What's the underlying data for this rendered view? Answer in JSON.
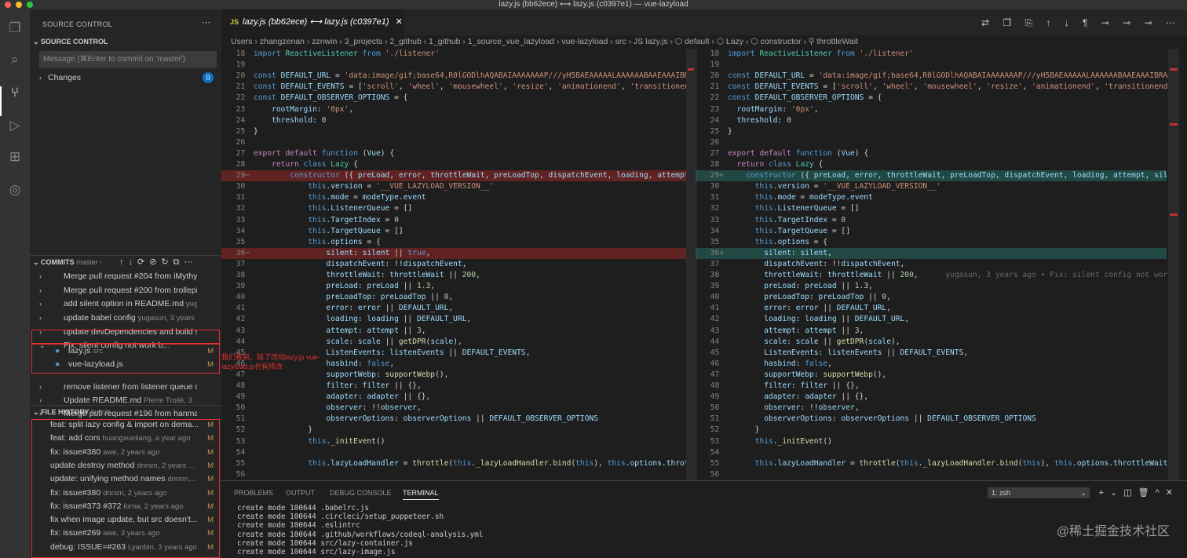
{
  "window": {
    "title": "lazy.js (bb62ece) ⟷ lazy.js (c0397e1) — vue-lazyload"
  },
  "activity": [
    "files-icon",
    "search-icon",
    "source-control-icon",
    "run-debug-icon",
    "extensions-icon",
    "git-graph-icon"
  ],
  "sidebar": {
    "header": "SOURCE CONTROL",
    "section": "SOURCE CONTROL",
    "message_placeholder": "Message (⌘Enter to commit on 'master')",
    "changes_label": "Changes",
    "changes_count": "0",
    "commits_label": "COMMITS",
    "commits_branch": "master -",
    "commits": [
      {
        "msg": "Merge pull request #204 from iMythy...",
        "author": ""
      },
      {
        "msg": "Merge pull request #200 from trollepi...",
        "author": ""
      },
      {
        "msg": "add silent option in README.md",
        "author": "yuga..."
      },
      {
        "msg": "update babel config",
        "author": "yugasun, 3 years a..."
      },
      {
        "msg": "update devDependencies and build sc...",
        "author": ""
      },
      {
        "msg": "Fix: silent config not work b...",
        "author": ""
      },
      {
        "msg": "remove listener from listener queue o...",
        "author": ""
      },
      {
        "msg": "Update README.md",
        "author": "Pierre Trollé, 3 ..."
      },
      {
        "msg": "Merge pull request #196 from hanmac...",
        "author": ""
      }
    ],
    "files": [
      {
        "name": "lazy.js",
        "dir": "src",
        "status": "M"
      },
      {
        "name": "vue-lazyload.js",
        "dir": "",
        "status": "M"
      }
    ],
    "history_label": "FILE HISTORY",
    "history_file": "lazy.js",
    "history": [
      {
        "msg": "feat: split lazy config & import on dema...",
        "author": "",
        "status": "M"
      },
      {
        "msg": "feat: add cors",
        "author": "huangxueliang, a year ago",
        "status": "M"
      },
      {
        "msg": "fix: issue#380",
        "author": "awe, 2 years ago",
        "status": "M"
      },
      {
        "msg": "update destroy method",
        "author": "dnrsm, 2 years ...",
        "status": "M"
      },
      {
        "msg": "update: unifying method names",
        "author": "dnrsm,...",
        "status": "M"
      },
      {
        "msg": "fix: issue#380",
        "author": "dnrsm, 2 years ago",
        "status": "M"
      },
      {
        "msg": "fix: issue#373 #372",
        "author": "lorna, 2 years ago",
        "status": "M"
      },
      {
        "msg": "fix when image update, but src doesn't...",
        "author": "",
        "status": "M"
      },
      {
        "msg": "fix: issue#269",
        "author": "awe, 3 years ago",
        "status": "M"
      },
      {
        "msg": "debug: ISSUE=#263",
        "author": "Lyanbin, 3 years ago",
        "status": "M"
      }
    ]
  },
  "annotation": "我们看到，除了改动lazy.js vue-lazyload.js也有修改",
  "editor": {
    "tab": "lazy.js (bb62ece) ⟷ lazy.js (c0397e1)",
    "tab_icon": "JS",
    "toolbar": "⇄ ❐ ⎘ ↑ ↓ ¶ ⊸ ⊸ ⊸ ⋯",
    "breadcrumb": "Users › zhangzenan › zznwin › 3_projects › 2_github › 1_github › 1_source_vue_lazyload › vue-lazyload › src › JS lazy.js › ⬡ default › ⬡ Lazy › ⬡ constructor › ⚲ throttleWait",
    "blame": "yugasun, 3 years ago • Fix: silent config not wor",
    "left": [
      [
        "18",
        "<span class='k'>import</span> <span class='c'>ReactiveListener</span> <span class='k'>from</span> <span class='s'>'./listener'</span>",
        ""
      ],
      [
        "19",
        "",
        ""
      ],
      [
        "20",
        "<span class='k'>const</span> <span class='v'>DEFAULT_URL</span> = <span class='s'>'data:image/gif;base64,R0lGODlhAQABAIAAAAAAAP///yH5BAEAAAAALAAAAAABAAEAAAIBRAA7'</span>",
        ""
      ],
      [
        "21",
        "<span class='k'>const</span> <span class='v'>DEFAULT_EVENTS</span> = [<span class='s'>'scroll'</span>, <span class='s'>'wheel'</span>, <span class='s'>'mousewheel'</span>, <span class='s'>'resize'</span>, <span class='s'>'animationend'</span>, <span class='s'>'transitionend'</span>",
        ""
      ],
      [
        "22",
        "<span class='k'>const</span> <span class='v'>DEFAULT_OBSERVER_OPTIONS</span> = {",
        ""
      ],
      [
        "23",
        "    <span class='v'>rootMargin</span>: <span class='s'>'0px'</span>,",
        ""
      ],
      [
        "24",
        "    <span class='v'>threshold</span>: <span class='n'>0</span>",
        ""
      ],
      [
        "25",
        "}",
        ""
      ],
      [
        "26",
        "",
        ""
      ],
      [
        "27",
        "<span class='p'>export</span> <span class='p'>default</span> <span class='k'>function</span> (<span class='v'>Vue</span>) {",
        ""
      ],
      [
        "28",
        "    <span class='p'>return</span> <span class='k'>class</span> <span class='c'>Lazy</span> {",
        ""
      ],
      [
        "29",
        "        <span class='k'>constructor</span> ({ <span class='v'>preLoad</span>, <span class='v'>error</span>, <span class='v'>throttleWait</span>, <span class='v'>preLoadTop</span>, <span class='v'>dispatchEvent</span>, <span class='v'>loading</span>, <span class='v'>attempt</span>, <span class='v'>s</span>",
        "del"
      ],
      [
        "30",
        "            <span class='k'>this</span>.<span class='v'>version</span> = <span class='s'>'__VUE_LAZYLOAD_VERSION__'</span>",
        ""
      ],
      [
        "31",
        "            <span class='k'>this</span>.<span class='v'>mode</span> = <span class='v'>modeType</span>.<span class='v'>event</span>",
        ""
      ],
      [
        "32",
        "            <span class='k'>this</span>.<span class='v'>ListenerQueue</span> = []",
        ""
      ],
      [
        "33",
        "            <span class='k'>this</span>.<span class='v'>TargetIndex</span> = <span class='n'>0</span>",
        ""
      ],
      [
        "34",
        "            <span class='k'>this</span>.<span class='v'>TargetQueue</span> = []",
        ""
      ],
      [
        "35",
        "            <span class='k'>this</span>.<span class='v'>options</span> = {",
        ""
      ],
      [
        "36",
        "                <span class='v'>silent</span>: <span class='v'>silent</span> || <span class='k'>true</span>,",
        "del"
      ],
      [
        "37",
        "                <span class='v'>dispatchEvent</span>: !!<span class='v'>dispatchEvent</span>,",
        ""
      ],
      [
        "38",
        "                <span class='v'>throttleWait</span>: <span class='v'>throttleWait</span> || <span class='n'>200</span>,",
        ""
      ],
      [
        "39",
        "                <span class='v'>preLoad</span>: <span class='v'>preLoad</span> || <span class='n'>1.3</span>,",
        ""
      ],
      [
        "40",
        "                <span class='v'>preLoadTop</span>: <span class='v'>preLoadTop</span> || <span class='n'>0</span>,",
        ""
      ],
      [
        "41",
        "                <span class='v'>error</span>: <span class='v'>error</span> || <span class='v'>DEFAULT_URL</span>,",
        ""
      ],
      [
        "42",
        "                <span class='v'>loading</span>: <span class='v'>loading</span> || <span class='v'>DEFAULT_URL</span>,",
        ""
      ],
      [
        "43",
        "                <span class='v'>attempt</span>: <span class='v'>attempt</span> || <span class='n'>3</span>,",
        ""
      ],
      [
        "44",
        "                <span class='v'>scale</span>: <span class='v'>scale</span> || <span class='f'>getDPR</span>(<span class='v'>scale</span>),",
        ""
      ],
      [
        "45",
        "                <span class='v'>ListenEvents</span>: <span class='v'>listenEvents</span> || <span class='v'>DEFAULT_EVENTS</span>,",
        ""
      ],
      [
        "46",
        "                <span class='v'>hasbind</span>: <span class='k'>false</span>,",
        ""
      ],
      [
        "47",
        "                <span class='v'>supportWebp</span>: <span class='f'>supportWebp</span>(),",
        ""
      ],
      [
        "48",
        "                <span class='v'>filter</span>: <span class='v'>filter</span> || {},",
        ""
      ],
      [
        "49",
        "                <span class='v'>adapter</span>: <span class='v'>adapter</span> || {},",
        ""
      ],
      [
        "50",
        "                <span class='v'>observer</span>: !!<span class='v'>observer</span>,",
        ""
      ],
      [
        "51",
        "                <span class='v'>observerOptions</span>: <span class='v'>observerOptions</span> || <span class='v'>DEFAULT_OBSERVER_OPTIONS</span>",
        ""
      ],
      [
        "52",
        "            }",
        ""
      ],
      [
        "53",
        "            <span class='k'>this</span>.<span class='f'>_initEvent</span>()",
        ""
      ],
      [
        "54",
        "",
        ""
      ],
      [
        "55",
        "            <span class='k'>this</span>.<span class='v'>lazyLoadHandler</span> = <span class='f'>throttle</span>(<span class='k'>this</span>.<span class='f'>_lazyLoadHandler</span>.<span class='f'>bind</span>(<span class='k'>this</span>), <span class='k'>this</span>.<span class='v'>options</span>.<span class='v'>throttl</span>",
        ""
      ],
      [
        "56",
        "",
        ""
      ]
    ],
    "right": [
      [
        "18",
        "<span class='k'>import</span> <span class='c'>ReactiveListener</span> <span class='k'>from</span> <span class='s'>'./listener'</span>",
        ""
      ],
      [
        "19",
        "",
        ""
      ],
      [
        "20",
        "<span class='k'>const</span> <span class='v'>DEFAULT_URL</span> = <span class='s'>'data:image/gif;base64,R0lGODlhAQABAIAAAAAAAP///yH5BAEAAAAALAAAAAABAAEAAAIBRAA7'</span>",
        ""
      ],
      [
        "21",
        "<span class='k'>const</span> <span class='v'>DEFAULT_EVENTS</span> = [<span class='s'>'scroll'</span>, <span class='s'>'wheel'</span>, <span class='s'>'mousewheel'</span>, <span class='s'>'resize'</span>, <span class='s'>'animationend'</span>, <span class='s'>'transitionend'</span>",
        ""
      ],
      [
        "22",
        "<span class='k'>const</span> <span class='v'>DEFAULT_OBSERVER_OPTIONS</span> = {",
        ""
      ],
      [
        "23",
        "  <span class='v'>rootMargin</span>: <span class='s'>'0px'</span>,",
        ""
      ],
      [
        "24",
        "  <span class='v'>threshold</span>: <span class='n'>0</span>",
        ""
      ],
      [
        "25",
        "}",
        ""
      ],
      [
        "26",
        "",
        ""
      ],
      [
        "27",
        "<span class='p'>export</span> <span class='p'>default</span> <span class='k'>function</span> (<span class='v'>Vue</span>) {",
        ""
      ],
      [
        "28",
        "  <span class='p'>return</span> <span class='k'>class</span> <span class='c'>Lazy</span> {",
        ""
      ],
      [
        "29",
        "    <span class='k'>constructor</span> ({ <span class='v'>preLoad</span>, <span class='v'>error</span>, <span class='v'>throttleWait</span>, <span class='v'>preLoadTop</span>, <span class='v'>dispatchEvent</span>, <span class='v'>loading</span>, <span class='v'>attempt</span>, <span class='v'>silen</span>",
        "add"
      ],
      [
        "30",
        "      <span class='k'>this</span>.<span class='v'>version</span> = <span class='s'>'__VUE_LAZYLOAD_VERSION__'</span>",
        ""
      ],
      [
        "31",
        "      <span class='k'>this</span>.<span class='v'>mode</span> = <span class='v'>modeType</span>.<span class='v'>event</span>",
        ""
      ],
      [
        "32",
        "      <span class='k'>this</span>.<span class='v'>ListenerQueue</span> = []",
        ""
      ],
      [
        "33",
        "      <span class='k'>this</span>.<span class='v'>TargetIndex</span> = <span class='n'>0</span>",
        ""
      ],
      [
        "34",
        "      <span class='k'>this</span>.<span class='v'>TargetQueue</span> = []",
        ""
      ],
      [
        "35",
        "      <span class='k'>this</span>.<span class='v'>options</span> = {",
        ""
      ],
      [
        "36",
        "        <span class='v'>silent</span>: <span class='v'>silent</span>,",
        "add"
      ],
      [
        "37",
        "        <span class='v'>dispatchEvent</span>: !!<span class='v'>dispatchEvent</span>,",
        ""
      ],
      [
        "38",
        "        <span class='v'>throttleWait</span>: <span class='v'>throttleWait</span> || <span class='n'>200</span>,      <span style='color:#6a6a6a'>yugasun, 3 years ago • Fix: silent config not wor</span>",
        ""
      ],
      [
        "39",
        "        <span class='v'>preLoad</span>: <span class='v'>preLoad</span> || <span class='n'>1.3</span>,",
        ""
      ],
      [
        "40",
        "        <span class='v'>preLoadTop</span>: <span class='v'>preLoadTop</span> || <span class='n'>0</span>,",
        ""
      ],
      [
        "41",
        "        <span class='v'>error</span>: <span class='v'>error</span> || <span class='v'>DEFAULT_URL</span>,",
        ""
      ],
      [
        "42",
        "        <span class='v'>loading</span>: <span class='v'>loading</span> || <span class='v'>DEFAULT_URL</span>,",
        ""
      ],
      [
        "43",
        "        <span class='v'>attempt</span>: <span class='v'>attempt</span> || <span class='n'>3</span>,",
        ""
      ],
      [
        "44",
        "        <span class='v'>scale</span>: <span class='v'>scale</span> || <span class='f'>getDPR</span>(<span class='v'>scale</span>),",
        ""
      ],
      [
        "45",
        "        <span class='v'>ListenEvents</span>: <span class='v'>listenEvents</span> || <span class='v'>DEFAULT_EVENTS</span>,",
        ""
      ],
      [
        "46",
        "        <span class='v'>hasbind</span>: <span class='k'>false</span>,",
        ""
      ],
      [
        "47",
        "        <span class='v'>supportWebp</span>: <span class='f'>supportWebp</span>(),",
        ""
      ],
      [
        "48",
        "        <span class='v'>filter</span>: <span class='v'>filter</span> || {},",
        ""
      ],
      [
        "49",
        "        <span class='v'>adapter</span>: <span class='v'>adapter</span> || {},",
        ""
      ],
      [
        "50",
        "        <span class='v'>observer</span>: !!<span class='v'>observer</span>,",
        ""
      ],
      [
        "51",
        "        <span class='v'>observerOptions</span>: <span class='v'>observerOptions</span> || <span class='v'>DEFAULT_OBSERVER_OPTIONS</span>",
        ""
      ],
      [
        "52",
        "      }",
        ""
      ],
      [
        "53",
        "      <span class='k'>this</span>.<span class='f'>_initEvent</span>()",
        ""
      ],
      [
        "54",
        "",
        ""
      ],
      [
        "55",
        "      <span class='k'>this</span>.<span class='v'>lazyLoadHandler</span> = <span class='f'>throttle</span>(<span class='k'>this</span>.<span class='f'>_lazyLoadHandler</span>.<span class='f'>bind</span>(<span class='k'>this</span>), <span class='k'>this</span>.<span class='v'>options</span>.<span class='v'>throttleWait</span>)",
        ""
      ],
      [
        "56",
        "",
        ""
      ]
    ]
  },
  "panel": {
    "tabs": [
      "PROBLEMS",
      "OUTPUT",
      "DEBUG CONSOLE",
      "TERMINAL"
    ],
    "active": "TERMINAL",
    "shell": "1: zsh",
    "terminal": "create mode 100644 .babelrc.js\ncreate mode 100644 .circleci/setup_puppeteer.sh\ncreate mode 100644 .eslintrc\ncreate mode 100644 .github/workflows/codeql-analysis.yml\ncreate mode 100644 src/lazy-container.js\ncreate mode 100644 src/lazy-image.js"
  },
  "watermark": "@稀土掘金技术社区"
}
